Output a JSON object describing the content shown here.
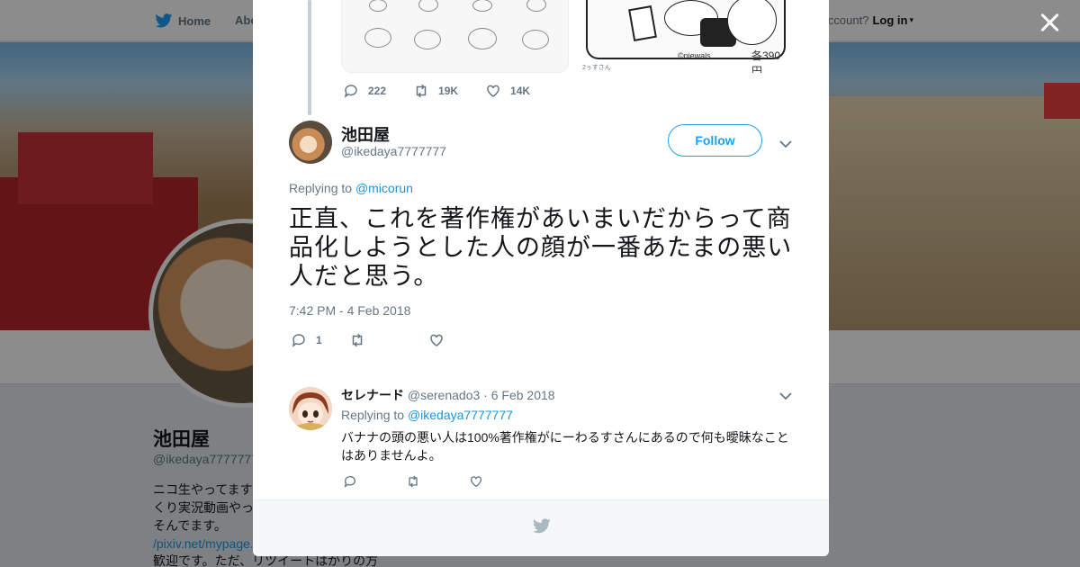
{
  "nav": {
    "home_label": "Home",
    "about_label": "Abo",
    "account_prompt": "ccount?",
    "login_label": "Log in"
  },
  "profile": {
    "name": "池田屋",
    "handle": "@ikedaya7777777",
    "bio_lines": [
      "ニコ生やってます",
      "くり実況動画やっ",
      "そんでます。"
    ],
    "bio_link": "/pixiv.net/mypage.",
    "bio_last": "歓迎です。ただ、リツイートはがりの方"
  },
  "parent_tweet": {
    "reply_count": "222",
    "retweet_count": "19K",
    "like_count": "14K",
    "media2_brand": "©niewals",
    "media2_price": "各390円",
    "media2_credit": "2ぅすさん"
  },
  "main_tweet": {
    "name": "池田屋",
    "handle": "@ikedaya7777777",
    "follow_label": "Follow",
    "replying_prefix": "Replying to",
    "replying_to": "@micorun",
    "text": "正直、これを著作権があいまいだからって商品化しようとした人の顔が一番あたまの悪い人だと思う。",
    "timestamp": "7:42 PM - 4 Feb 2018",
    "reply_count": "1"
  },
  "reply_tweet": {
    "name": "セレナード",
    "handle": "@serenado3",
    "separator": "·",
    "date": "6 Feb 2018",
    "replying_prefix": "Replying to",
    "replying_to": "@ikedaya7777777",
    "text": "バナナの頭の悪い人は100%著作権がにーわるすさんにあるので何も曖昧なことはありませんよ。"
  },
  "colors": {
    "accent": "#1da1f2",
    "link": "#1b95e0",
    "secondary_text": "#657786",
    "overlay": "rgba(0,0,0,0.45)"
  },
  "icons": [
    "twitter-bird-icon",
    "close-icon",
    "reply-icon",
    "retweet-icon",
    "like-icon",
    "chevron-down-icon"
  ]
}
